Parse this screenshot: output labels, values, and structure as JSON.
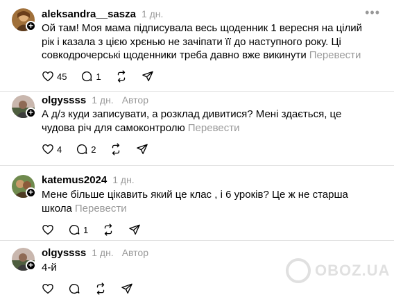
{
  "comments": [
    {
      "username": "aleksandra__sasza",
      "time": "1 дн.",
      "author_label": "",
      "text": "Ой там! Моя мама підписувала весь щоденник 1 вересня на цілий рік і казала з цією хрєнью не зачіпати її до наступного року. Ці совкодрочерські щоденники треба давно вже викинути",
      "translate": "Перевести",
      "likes": "45",
      "replies": "1",
      "reposts": "",
      "avatar_colors": [
        "#8a5a2b",
        "#c79a5c"
      ]
    },
    {
      "username": "olgyssss",
      "time": "1 дн.",
      "author_label": "Автор",
      "text": "А д/з куди записувати, а розклад дивитися? Мені здається, це чудова річ для самоконтролю",
      "translate": "Перевести",
      "likes": "4",
      "replies": "2",
      "reposts": "",
      "avatar_colors": [
        "#5a6b4c",
        "#b8a7a0"
      ]
    },
    {
      "username": "katemus2024",
      "time": "1 дн.",
      "author_label": "",
      "text": "Мене більше цікавить який це клас , і 6 уроків? Це ж не старша школа",
      "translate": "Перевести",
      "likes": "",
      "replies": "1",
      "reposts": "",
      "avatar_colors": [
        "#7a6a3a",
        "#5b7a4a"
      ]
    },
    {
      "username": "olgyssss",
      "time": "1 дн.",
      "author_label": "Автор",
      "text": "4-й",
      "translate": "",
      "likes": "",
      "replies": "",
      "reposts": "",
      "avatar_colors": [
        "#5a6b4c",
        "#b8a7a0"
      ]
    }
  ],
  "more_icon": "more-horizontal-icon",
  "watermark": {
    "text": "OBOZ.UA"
  }
}
